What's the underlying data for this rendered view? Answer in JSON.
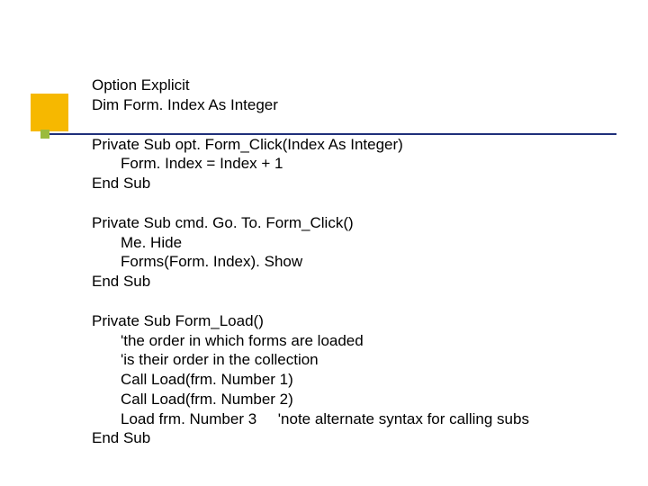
{
  "code": {
    "l1": "Option Explicit",
    "l2": "Dim Form. Index As Integer",
    "l3": "Private Sub opt. Form_Click(Index As Integer)",
    "l4": "Form. Index = Index + 1",
    "l5": "End Sub",
    "l6": "Private Sub cmd. Go. To. Form_Click()",
    "l7": "Me. Hide",
    "l8": "Forms(Form. Index). Show",
    "l9": "End Sub",
    "l10": "Private Sub Form_Load()",
    "l11": "'the order in which forms are loaded",
    "l12": "'is their order in the collection",
    "l13": "Call Load(frm. Number 1)",
    "l14": "Call Load(frm. Number 2)",
    "l15": "Load frm. Number 3     'note alternate syntax for calling subs",
    "l16": "End Sub"
  }
}
